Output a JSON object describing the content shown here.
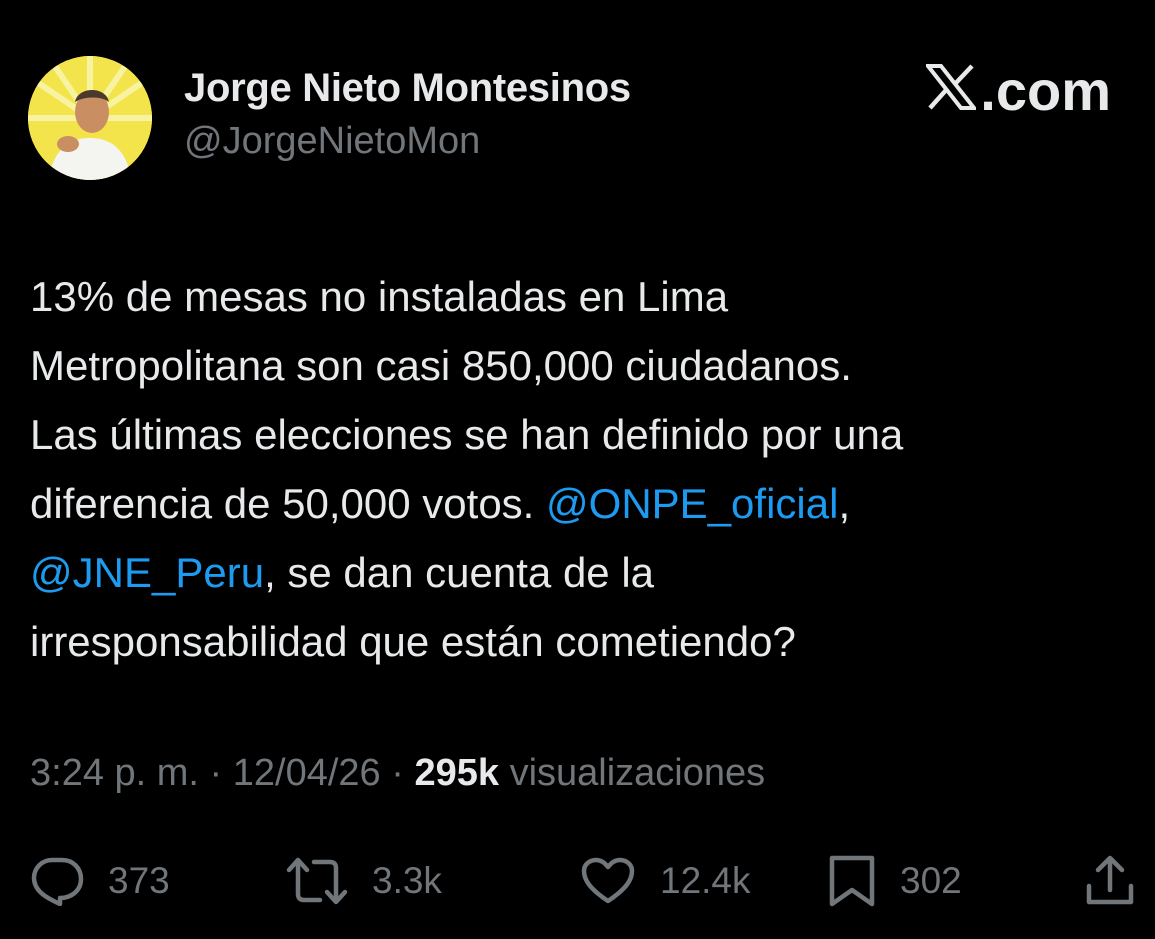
{
  "brand": {
    "label": ".com"
  },
  "author": {
    "name": "Jorge Nieto Montesinos",
    "handle": "@JorgeNietoMon"
  },
  "tweet": {
    "line1": "13% de mesas no instaladas en Lima",
    "line2": "Metropolitana son casi 850,000 ciudadanos.",
    "line3": "Las últimas elecciones se han definido por una",
    "line4_text": "diferencia de 50,000 votos. ",
    "mention1": "@ONPE_oficial",
    "line4_tail": ",",
    "mention2": "@JNE_Peru",
    "line5_text": ", se dan cuenta de la",
    "line6": "irresponsabilidad que están cometiendo?"
  },
  "meta": {
    "time": "3:24 p. m.",
    "sep1": " · ",
    "date": "12/04/26",
    "sep2": " · ",
    "views": "295k",
    "views_label": " visualizaciones"
  },
  "actions": {
    "replies": "373",
    "reposts": "3.3k",
    "likes": "12.4k",
    "bookmarks": "302"
  },
  "colors": {
    "background": "#000000",
    "text": "#e7e9ea",
    "secondary": "#71767b",
    "mention": "#1d9bf0",
    "avatar_bg": "#f2e44a"
  },
  "icons": {
    "brand": "x-logo-icon",
    "reply": "reply-icon",
    "repost": "repost-icon",
    "like": "heart-icon",
    "bookmark": "bookmark-icon",
    "share": "share-icon"
  }
}
